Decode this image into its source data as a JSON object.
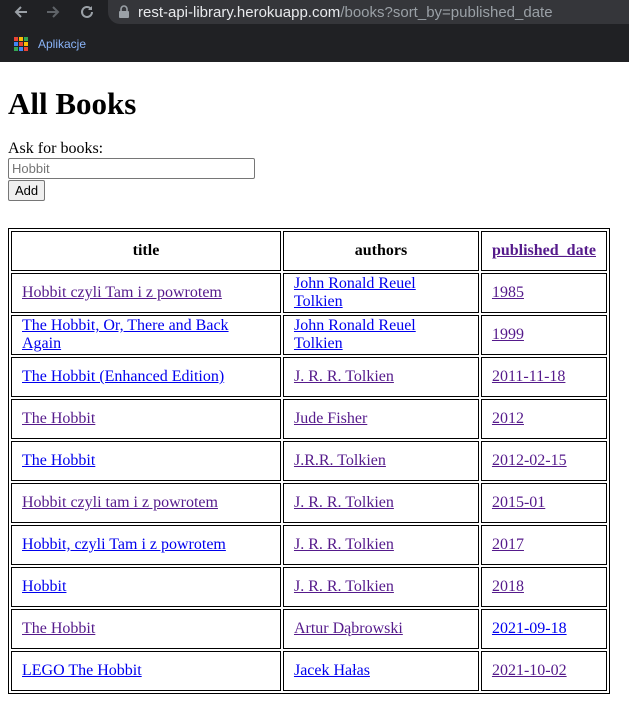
{
  "browser": {
    "url_host": "rest-api-library.herokuapp.com",
    "url_path": "/books?sort_by=published_date",
    "bookmarks_label": "Aplikacje"
  },
  "page": {
    "title": "All Books",
    "form_label": "Ask for books:",
    "search_placeholder": "Hobbit",
    "add_label": "Add"
  },
  "table": {
    "headers": {
      "title": "title",
      "authors": "authors",
      "published_date": "published_date"
    },
    "rows": [
      {
        "title": "Hobbit czyli Tam i z powrotem",
        "authors": "John Ronald Reuel Tolkien",
        "date": "1985"
      },
      {
        "title": "The Hobbit, Or, There and Back Again",
        "authors": "John Ronald Reuel Tolkien",
        "date": "1999"
      },
      {
        "title": "The Hobbit (Enhanced Edition)",
        "authors": "J. R. R. Tolkien",
        "date": "2011-11-18"
      },
      {
        "title": "The Hobbit",
        "authors": "Jude Fisher",
        "date": "2012"
      },
      {
        "title": "The Hobbit",
        "authors": "J.R.R. Tolkien",
        "date": "2012-02-15"
      },
      {
        "title": "Hobbit czyli tam i z powrotem",
        "authors": "J. R. R. Tolkien",
        "date": "2015-01"
      },
      {
        "title": "Hobbit, czyli Tam i z powrotem",
        "authors": "J. R. R. Tolkien",
        "date": "2017"
      },
      {
        "title": "Hobbit",
        "authors": "J. R. R. Tolkien",
        "date": "2018"
      },
      {
        "title": "The Hobbit",
        "authors": "Artur Dąbrowski",
        "date": "2021-09-18"
      },
      {
        "title": "LEGO The Hobbit",
        "authors": "Jacek Hałas",
        "date": "2021-10-02"
      }
    ]
  }
}
